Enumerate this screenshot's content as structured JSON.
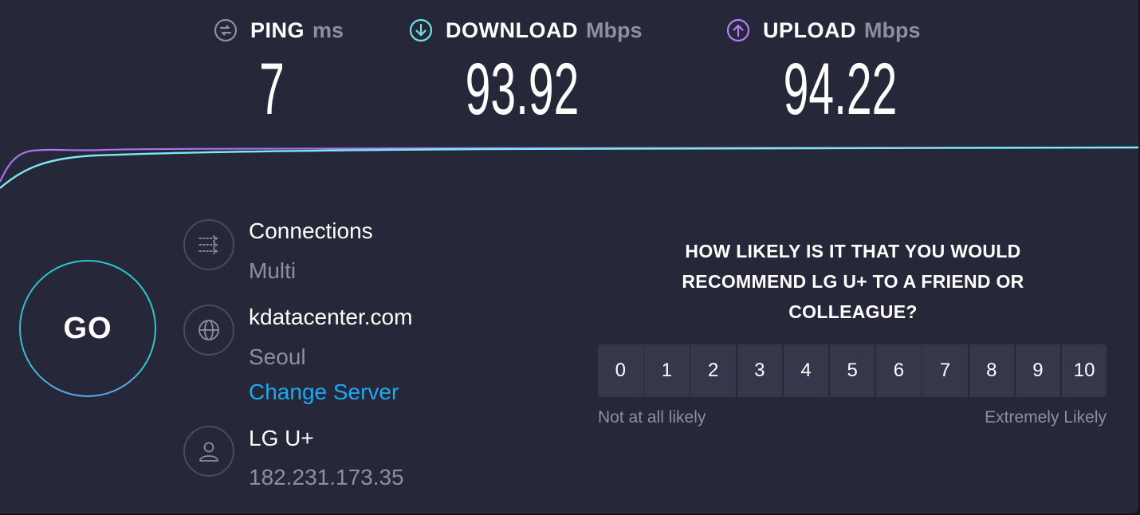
{
  "metrics": {
    "ping": {
      "label": "PING",
      "unit": "ms",
      "value": "7",
      "icon": "ping-icon"
    },
    "download": {
      "label": "DOWNLOAD",
      "unit": "Mbps",
      "value": "93.92",
      "icon": "download-arrow-icon"
    },
    "upload": {
      "label": "UPLOAD",
      "unit": "Mbps",
      "value": "94.22",
      "icon": "upload-arrow-icon"
    }
  },
  "go_button": {
    "label": "GO"
  },
  "connections": {
    "title": "Connections",
    "value": "Multi",
    "icon": "connections-icon"
  },
  "server": {
    "host": "kdatacenter.com",
    "location": "Seoul",
    "change_label": "Change Server",
    "icon": "globe-icon"
  },
  "provider": {
    "name": "LG U+",
    "ip": "182.231.173.35",
    "icon": "user-icon"
  },
  "survey": {
    "question": "HOW LIKELY IS IT THAT YOU WOULD RECOMMEND LG U+ TO A FRIEND OR COLLEAGUE?",
    "scale": [
      "0",
      "1",
      "2",
      "3",
      "4",
      "5",
      "6",
      "7",
      "8",
      "9",
      "10"
    ],
    "low_label": "Not at all likely",
    "high_label": "Extremely Likely"
  },
  "colors": {
    "background": "#262839",
    "download_accent": "#6ae3e7",
    "upload_accent": "#9b6bf2",
    "link": "#1ea8f0",
    "muted_text": "#8d8fa0"
  }
}
